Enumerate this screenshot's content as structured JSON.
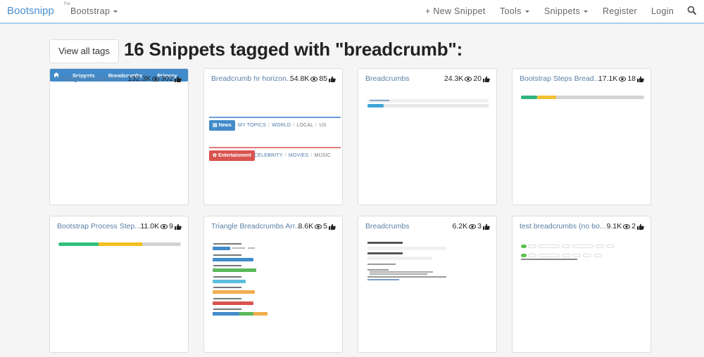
{
  "navbar": {
    "brand": "Bootsnipp",
    "for_label": "For",
    "framework": "Bootstrap",
    "items": [
      {
        "label": "+ New Snippet",
        "dropdown": false
      },
      {
        "label": "Tools",
        "dropdown": true
      },
      {
        "label": "Snippets",
        "dropdown": true
      },
      {
        "label": "Register",
        "dropdown": false
      },
      {
        "label": "Login",
        "dropdown": false
      }
    ],
    "search_icon": "search-icon",
    "accent_color": "#4a90d0"
  },
  "header": {
    "view_all_tags": "View all tags",
    "title": "16 Snippets tagged with \"breadcrumb\":"
  },
  "cards": [
    {
      "title": "Triangle Breadcrum...",
      "views": "132.3K",
      "likes": "302",
      "preview": {
        "items": [
          "Snippets",
          "Breadcrumbs",
          "Primary"
        ],
        "color": "#428bca"
      }
    },
    {
      "title": "Breadcrumb hr horizon...",
      "views": "54.8K",
      "likes": "85",
      "preview": {
        "row1": {
          "badge": "News",
          "links": [
            "MY TOPICS",
            "WORLD",
            "LOCAL",
            "US"
          ],
          "color": "#428bca"
        },
        "row2": {
          "badge": "Entertainment",
          "links": [
            "CELEBRITY",
            "MOVIES",
            "MUSIC"
          ],
          "color": "#d9534f"
        },
        "separator": "/"
      }
    },
    {
      "title": "Breadcrumbs",
      "views": "24.3K",
      "likes": "20"
    },
    {
      "title": "Bootstrap Steps Bread...",
      "views": "17.1K",
      "likes": "18"
    },
    {
      "title": "Bootstrap Process Step...",
      "views": "11.0K",
      "likes": "9"
    },
    {
      "title": "Triangle Breadcrumbs Arr...",
      "views": "8.6K",
      "likes": "5"
    },
    {
      "title": "Breadcrumbs",
      "views": "6.2K",
      "likes": "3"
    },
    {
      "title": "test breadcrumbs (no bo...",
      "views": "9.1K",
      "likes": "2"
    }
  ]
}
